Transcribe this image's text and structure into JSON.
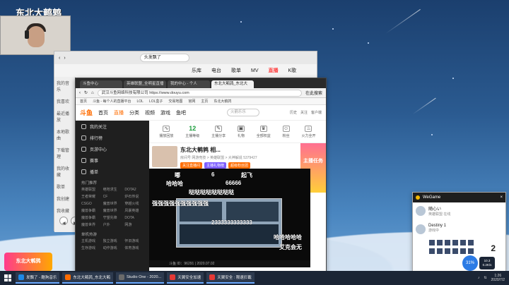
{
  "brand_text": "东北大鹌鹑",
  "music_app": {
    "search_placeholder": "头发飘了",
    "nav": [
      "乐库",
      "电台",
      "歌单",
      "MV",
      "直播",
      "K歌"
    ],
    "active_nav": "直播",
    "sidebar": [
      "我的音乐",
      "我喜欢",
      "最近播放",
      "本地歌曲",
      "下载管理",
      "我的收藏",
      "歌单",
      "我创建",
      "我收藏"
    ]
  },
  "browser": {
    "tabs": [
      "斗鱼中心",
      "英雄联盟_全明星直播",
      "我的中心 - 个人",
      "东北大鹌鹑_东北大"
    ],
    "active_tab": 3,
    "url": "https://www.douyu.com",
    "company": "武汉斗鱼网络科技有限公司",
    "search_placeholder": "在此搜索",
    "bookmarks": [
      "首页",
      "斗鱼 - 每个人的直播平台",
      "LOL",
      "LOL盒子",
      "交易地图",
      "官网",
      "主页",
      "东北大鹌鹑"
    ],
    "site": {
      "logo": "斗鱼",
      "nav": [
        "首页",
        "直播",
        "分类",
        "视频",
        "游戏",
        "鱼吧"
      ],
      "active_nav": "直播",
      "search_placeholder": "火箭乐乐",
      "icons": [
        "历史",
        "关注",
        "客户端"
      ]
    },
    "leftnav": {
      "items": [
        "我的关注",
        "排行榜",
        "页游中心",
        "赛事",
        "播单"
      ],
      "section_hot": "热门推荐",
      "games": [
        "英雄联盟",
        "绝地求生",
        "DOTA2",
        "王者荣耀",
        "CF",
        "炉石传说",
        "CSGO",
        "魔兽世界",
        "穿越火线",
        "魔兽争霸",
        "魔兽世界",
        "风暴英雄",
        "魔兽争霸",
        "守望先锋",
        "DOTA",
        "魔兽世界",
        "户外",
        "网游"
      ],
      "section_single": "单机热游",
      "singles": [
        "主机游戏",
        "独立游戏",
        "怀旧游戏",
        "生存游戏",
        "动作游戏",
        "体育游戏"
      ]
    },
    "toolbar": [
      {
        "label": "播放回放",
        "icon": "wave"
      },
      {
        "label": "主播等级",
        "value": "12"
      },
      {
        "label": "主播分享",
        "icon": "edit"
      },
      {
        "label": "礼物",
        "icon": "gift"
      },
      {
        "label": "全部权益",
        "icon": "crown"
      },
      {
        "label": "粉丝",
        "icon": "fans"
      },
      {
        "label": "火力全开",
        "icon": "fire"
      }
    ],
    "streamer": {
      "name": "东北大鹌鹑 相...",
      "meta": "房间号 网游竞技 > 英雄联盟 > 大神解说",
      "followers": "5379427",
      "buttons": [
        "关注直播间",
        "主播礼物榜",
        "超级粉丝团"
      ]
    },
    "promo": "主播任务",
    "video_status": "斗鱼 ID：96291 | 2020.07.02",
    "danmu": [
      "嘟",
      "6",
      "起飞",
      "哈哈哈",
      "66666",
      "哒哒哒哒哒哒哒哒",
      "强强强强强强强强强强",
      "2333333333333",
      "哈哈哈哈哈",
      "艾克会无"
    ]
  },
  "wegame": {
    "title": "WeGame",
    "user1": {
      "name": "随心い",
      "sub": "英雄联盟",
      "status": "在线"
    },
    "user2": {
      "name": "Destiny 1",
      "sub": "游戏中"
    },
    "score": "2"
  },
  "taskbar": {
    "apps": [
      "发飘了 - 酷狗音乐",
      "东北大鹌鹑_东北大鹌",
      "Studio One - 2020...",
      "天翼安全加速",
      "天翼安全 : 限速拦截"
    ],
    "time": "1:26",
    "date": "2020/7/2",
    "gauge_left": "31%",
    "gauge_right_top": "10.3",
    "gauge_right_bottom": "0.2K/s"
  },
  "bottom_badge": "东北大鹌鹑"
}
